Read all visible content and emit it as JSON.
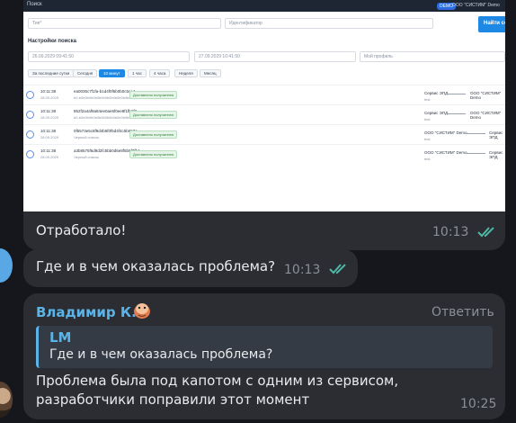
{
  "screenshot": {
    "app_title": "Поиск",
    "org_badge": "DEMO",
    "org_name": "ООО \"СИСТИМ\" Demo",
    "search_placeholder": "Тип*",
    "id_placeholder": "Идентификатор",
    "search_button": "Найти со",
    "section_title": "Настройки поиска",
    "date_from": "26.09.2029 09:41:50",
    "date_to": "27.09.2029 10:41:50",
    "extra_placeholder": "Мой профиль",
    "chips": [
      "За последние сутки",
      "Сегодня",
      "10 минут",
      "1 час",
      "4 часа",
      "Неделя",
      "Месяц"
    ],
    "active_chip": 2,
    "rows": [
      {
        "time": "10:11:38",
        "date": "28.09.2029",
        "hash": "ea0035c7f1fa-b1d4f0f6b0b0c5ce4",
        "hash2": "b0-b0b0b0b0b0b0b0b0b0b0b0b0b0b0b0",
        "status": "Доставлено получателю",
        "from": "Сервис ЭПД",
        "from_sub": "test",
        "to": "ООО \"СИСТИМ\" Demo"
      },
      {
        "time": "10:11:38",
        "date": "28.09.2029",
        "hash": "852f2a4af9a84ee0ae5f0ee8f1fb6f8",
        "hash2": "b0-b0b0b0b0b0b0b0b0b0b0b0b0b0b0b0",
        "status": "Доставлено получателю",
        "from": "Сервис ЭПД",
        "from_sub": "test",
        "to": "ООО \"СИСТИМ\" Demo"
      },
      {
        "time": "10:11:38",
        "date": "28.09.2029",
        "hash": "0f5573e5c8f9d4b5f0f5d4f4c5b657a",
        "hash2": "Черный список",
        "status": "Доставлено получателю",
        "from": "ООО \"СИСТИМ\" Demo",
        "from_sub": "test",
        "to": "Сервис ЭПД"
      },
      {
        "time": "10:11:38",
        "date": "28.09.2029",
        "hash": "a3b8575f6d9d2fc5bb0d6e8f5b5f7fb4",
        "hash2": "Черный список",
        "status": "Доставлено получателю",
        "from": "ООО \"СИСТИМ\" Demo",
        "from_sub": "test",
        "to": "Сервис ЭПД"
      }
    ]
  },
  "message1": {
    "text": "Отработало!",
    "time": "10:13"
  },
  "message2": {
    "text": "Где и в чем оказалась проблема?",
    "time": "10:13"
  },
  "message3": {
    "sender": "Владимир К.",
    "reply_label": "Ответить",
    "quote_name": "LM",
    "quote_text": "Где и в чем оказалась проблема?",
    "line1": "Проблема была под капотом с одним из сервисом,",
    "line2": "разработчики поправили этот момент",
    "time": "10:25"
  },
  "colors": {
    "background": "#15171c",
    "bubble": "#2b2d33",
    "accent": "#5ab4e8",
    "check": "#4fb8a5"
  }
}
